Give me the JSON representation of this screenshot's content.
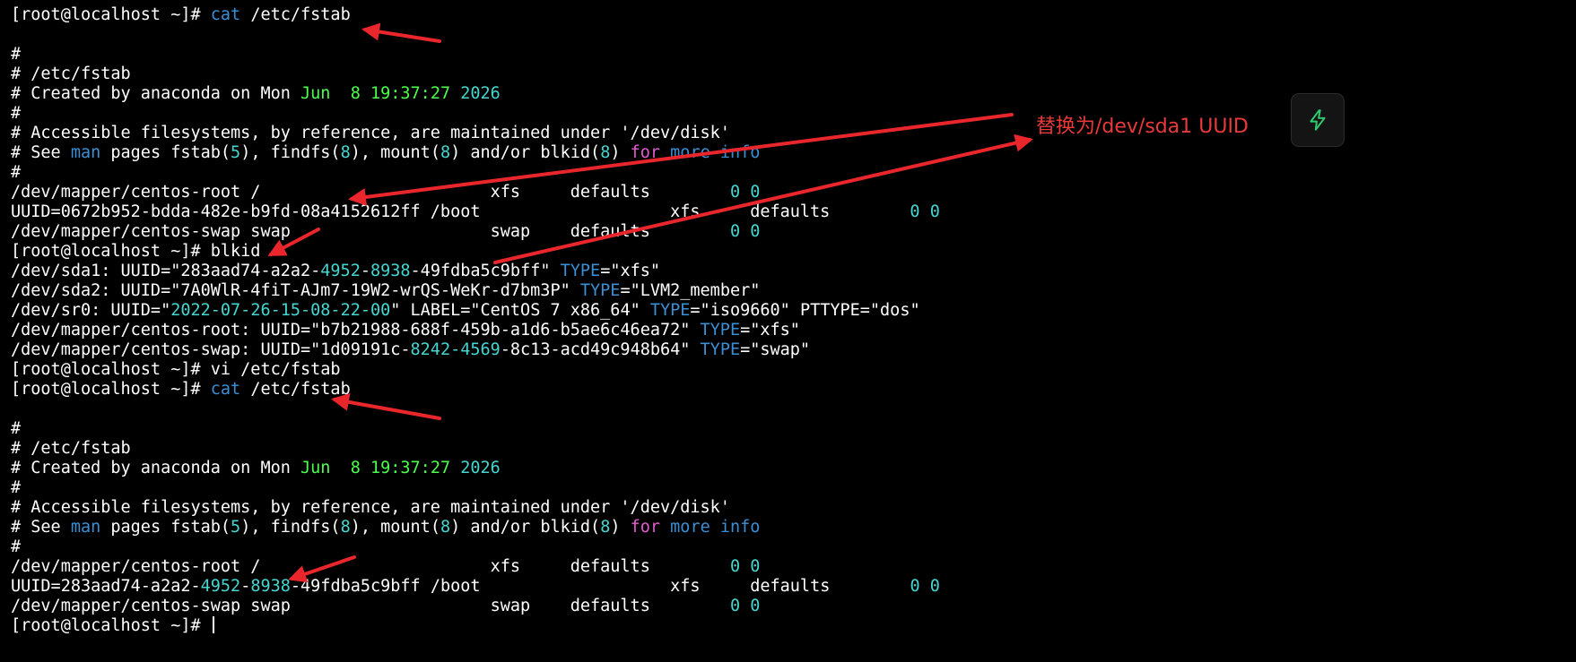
{
  "annotation": {
    "note": "替换为/dev/sda1 UUID",
    "arrow_color": "#e8262b"
  },
  "quick_action": {
    "icon": "lightning-bolt-icon",
    "icon_color": "#2ecc71"
  },
  "terminal": {
    "background": "#000000",
    "lines": [
      {
        "segs": [
          {
            "t": "[root@localhost ~]# ",
            "c": "w"
          },
          {
            "t": "cat",
            "c": "b"
          },
          {
            "t": " /etc/fstab",
            "c": "w"
          }
        ]
      },
      {
        "segs": []
      },
      {
        "segs": [
          {
            "t": "#",
            "c": "w"
          }
        ]
      },
      {
        "segs": [
          {
            "t": "# /etc/fstab",
            "c": "w"
          }
        ]
      },
      {
        "segs": [
          {
            "t": "# Created by anaconda on Mon ",
            "c": "w"
          },
          {
            "t": "Jun",
            "c": "g"
          },
          {
            "t": "  ",
            "c": "w"
          },
          {
            "t": "8 19:37:27",
            "c": "g"
          },
          {
            "t": " ",
            "c": "w"
          },
          {
            "t": "2026",
            "c": "c"
          }
        ]
      },
      {
        "segs": [
          {
            "t": "#",
            "c": "w"
          }
        ]
      },
      {
        "segs": [
          {
            "t": "# Accessible filesystems, by reference, are maintained under '/dev/disk'",
            "c": "w"
          }
        ]
      },
      {
        "segs": [
          {
            "t": "# See ",
            "c": "w"
          },
          {
            "t": "man",
            "c": "b"
          },
          {
            "t": " pages fstab(",
            "c": "w"
          },
          {
            "t": "5",
            "c": "c"
          },
          {
            "t": "), findfs(",
            "c": "w"
          },
          {
            "t": "8",
            "c": "c"
          },
          {
            "t": "), mount(",
            "c": "w"
          },
          {
            "t": "8",
            "c": "c"
          },
          {
            "t": ") and/or blkid(",
            "c": "w"
          },
          {
            "t": "8",
            "c": "c"
          },
          {
            "t": ") ",
            "c": "w"
          },
          {
            "t": "for",
            "c": "m"
          },
          {
            "t": " ",
            "c": "w"
          },
          {
            "t": "more",
            "c": "b"
          },
          {
            "t": " ",
            "c": "w"
          },
          {
            "t": "info",
            "c": "b"
          }
        ]
      },
      {
        "segs": [
          {
            "t": "#",
            "c": "w"
          }
        ]
      },
      {
        "segs": [
          {
            "t": "/dev/mapper/centos-root /                       xfs     defaults        ",
            "c": "w"
          },
          {
            "t": "0 0",
            "c": "c"
          }
        ]
      },
      {
        "segs": [
          {
            "t": "UUID=0672b952-bdda-482e-b9fd-08a4152612ff /boot                   xfs     defaults        ",
            "c": "w"
          },
          {
            "t": "0 0",
            "c": "c"
          }
        ]
      },
      {
        "segs": [
          {
            "t": "/dev/mapper/centos-swap swap                    swap    defaults        ",
            "c": "w"
          },
          {
            "t": "0 0",
            "c": "c"
          }
        ]
      },
      {
        "segs": [
          {
            "t": "[root@localhost ~]# blkid",
            "c": "w"
          }
        ]
      },
      {
        "segs": [
          {
            "t": "/dev/sda1: UUID=\"283aad74-a2a2-",
            "c": "w"
          },
          {
            "t": "4952",
            "c": "c"
          },
          {
            "t": "-",
            "c": "w"
          },
          {
            "t": "8938",
            "c": "c"
          },
          {
            "t": "-49fdba5c9bff\" ",
            "c": "w"
          },
          {
            "t": "TYPE",
            "c": "b"
          },
          {
            "t": "=\"xfs\"",
            "c": "w"
          }
        ]
      },
      {
        "segs": [
          {
            "t": "/dev/sda2: UUID=\"7A0WlR-4fiT-AJm7-19W2-wrQS-WeKr-d7bm3P\" ",
            "c": "w"
          },
          {
            "t": "TYPE",
            "c": "b"
          },
          {
            "t": "=\"LVM2_member\"",
            "c": "w"
          }
        ]
      },
      {
        "segs": [
          {
            "t": "/dev/sr0: UUID=\"",
            "c": "w"
          },
          {
            "t": "2022-07-26-15-08-22-00",
            "c": "c"
          },
          {
            "t": "\" LABEL=\"CentOS 7 x86_64\" ",
            "c": "w"
          },
          {
            "t": "TYPE",
            "c": "b"
          },
          {
            "t": "=\"iso9660\" PTTYPE=\"dos\"",
            "c": "w"
          }
        ]
      },
      {
        "segs": [
          {
            "t": "/dev/mapper/centos-root: UUID=\"b7b21988-688f-459b-a1d6-b5ae6c46ea72\" ",
            "c": "w"
          },
          {
            "t": "TYPE",
            "c": "b"
          },
          {
            "t": "=\"xfs\"",
            "c": "w"
          }
        ]
      },
      {
        "segs": [
          {
            "t": "/dev/mapper/centos-swap: UUID=\"1d09191c-",
            "c": "w"
          },
          {
            "t": "8242-4569",
            "c": "c"
          },
          {
            "t": "-8c13-acd49c948b64\" ",
            "c": "w"
          },
          {
            "t": "TYPE",
            "c": "b"
          },
          {
            "t": "=\"swap\"",
            "c": "w"
          }
        ]
      },
      {
        "segs": [
          {
            "t": "[root@localhost ~]# vi /etc/fstab",
            "c": "w"
          }
        ]
      },
      {
        "segs": [
          {
            "t": "[root@localhost ~]# ",
            "c": "w"
          },
          {
            "t": "cat",
            "c": "b"
          },
          {
            "t": " /etc/fstab",
            "c": "w"
          }
        ]
      },
      {
        "segs": []
      },
      {
        "segs": [
          {
            "t": "#",
            "c": "w"
          }
        ]
      },
      {
        "segs": [
          {
            "t": "# /etc/fstab",
            "c": "w"
          }
        ]
      },
      {
        "segs": [
          {
            "t": "# Created by anaconda on Mon ",
            "c": "w"
          },
          {
            "t": "Jun",
            "c": "g"
          },
          {
            "t": "  ",
            "c": "w"
          },
          {
            "t": "8 19:37:27",
            "c": "g"
          },
          {
            "t": " ",
            "c": "w"
          },
          {
            "t": "2026",
            "c": "c"
          }
        ]
      },
      {
        "segs": [
          {
            "t": "#",
            "c": "w"
          }
        ]
      },
      {
        "segs": [
          {
            "t": "# Accessible filesystems, by reference, are maintained under '/dev/disk'",
            "c": "w"
          }
        ]
      },
      {
        "segs": [
          {
            "t": "# See ",
            "c": "w"
          },
          {
            "t": "man",
            "c": "b"
          },
          {
            "t": " pages fstab(",
            "c": "w"
          },
          {
            "t": "5",
            "c": "c"
          },
          {
            "t": "), findfs(",
            "c": "w"
          },
          {
            "t": "8",
            "c": "c"
          },
          {
            "t": "), mount(",
            "c": "w"
          },
          {
            "t": "8",
            "c": "c"
          },
          {
            "t": ") and/or blkid(",
            "c": "w"
          },
          {
            "t": "8",
            "c": "c"
          },
          {
            "t": ") ",
            "c": "w"
          },
          {
            "t": "for",
            "c": "m"
          },
          {
            "t": " ",
            "c": "w"
          },
          {
            "t": "more",
            "c": "b"
          },
          {
            "t": " ",
            "c": "w"
          },
          {
            "t": "info",
            "c": "b"
          }
        ]
      },
      {
        "segs": [
          {
            "t": "#",
            "c": "w"
          }
        ]
      },
      {
        "segs": [
          {
            "t": "/dev/mapper/centos-root /                       xfs     defaults        ",
            "c": "w"
          },
          {
            "t": "0 0",
            "c": "c"
          }
        ]
      },
      {
        "segs": [
          {
            "t": "UUID=283aad74-a2a2-",
            "c": "w"
          },
          {
            "t": "4952",
            "c": "c"
          },
          {
            "t": "-",
            "c": "w"
          },
          {
            "t": "8938",
            "c": "c"
          },
          {
            "t": "-49fdba5c9bff /boot                   xfs     defaults        ",
            "c": "w"
          },
          {
            "t": "0 0",
            "c": "c"
          }
        ]
      },
      {
        "segs": [
          {
            "t": "/dev/mapper/centos-swap swap                    swap    defaults        ",
            "c": "w"
          },
          {
            "t": "0 0",
            "c": "c"
          }
        ]
      },
      {
        "segs": [
          {
            "t": "[root@localhost ~]# ",
            "c": "w"
          }
        ],
        "cursor": true
      }
    ]
  }
}
